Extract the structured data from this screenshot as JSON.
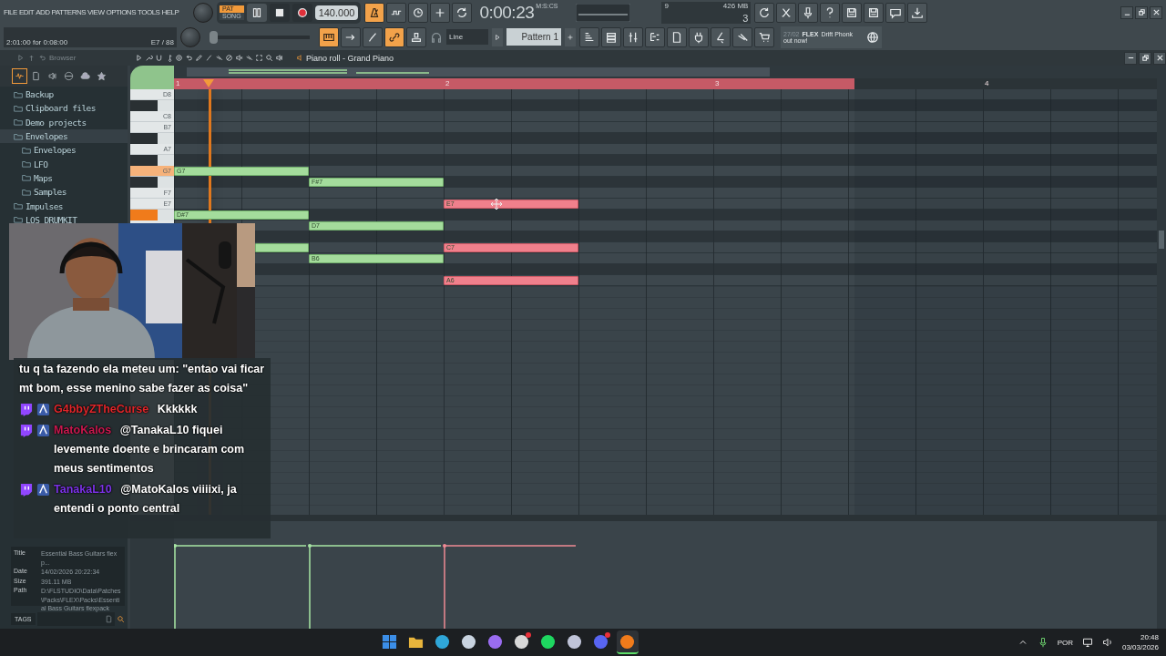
{
  "menu": [
    "FILE",
    "EDIT",
    "ADD",
    "PATTERNS",
    "VIEW",
    "OPTIONS",
    "TOOLS",
    "HELP"
  ],
  "hint": {
    "text": "2:01:00 for 0:08:00",
    "note": "E7 / 88"
  },
  "master": {
    "level": 0.0
  },
  "transport": {
    "modes": [
      {
        "label": "PAT",
        "selected": true
      },
      {
        "label": "SONG",
        "selected": false
      }
    ],
    "tempo": "140.000"
  },
  "time": {
    "label": "M:S:CS",
    "value": "0:00:23"
  },
  "monitor": {
    "polyphony": "9",
    "memory": "426 MB",
    "cpu": "3"
  },
  "snap": {
    "value": "Line"
  },
  "pattern": {
    "value": "Pattern 1"
  },
  "news": {
    "date": "27/02",
    "brand": "FLEX",
    "title": "Drift Phonk",
    "subtitle": "out now!"
  },
  "browser": {
    "title": "Browser",
    "items": [
      {
        "label": "Backup",
        "expanded": false
      },
      {
        "label": "Clipboard files",
        "expanded": false
      },
      {
        "label": "Demo projects",
        "expanded": false
      },
      {
        "label": "Envelopes",
        "expanded": true,
        "children": [
          {
            "label": "Envelopes"
          },
          {
            "label": "LFO"
          },
          {
            "label": "Maps"
          },
          {
            "label": "Samples"
          }
        ]
      },
      {
        "label": "Impulses",
        "expanded": false
      },
      {
        "label": "LOS DRUMKIT",
        "expanded": false
      }
    ],
    "info": [
      {
        "field": "Title",
        "value": "Essential Bass Guitars flexp..."
      },
      {
        "field": "Date",
        "value": "14/02/2026 20:22:34"
      },
      {
        "field": "Size",
        "value": "391.11 MB"
      },
      {
        "field": "Path",
        "value": "D:\\FLSTUDIO\\Data\\Patches\\Packs\\FLEX\\Packs\\Essential Bass Guitars flexpack"
      }
    ],
    "tags_label": "TAGS"
  },
  "piano_roll": {
    "title": "Piano roll - Grand Piano",
    "timeline": {
      "bars": [
        "1",
        "2",
        "3",
        "4"
      ],
      "song": {
        "level": 0.692
      },
      "playhead": {
        "level": 0.035
      }
    },
    "rows": [
      {
        "key": "D8",
        "black": false,
        "pressed": false
      },
      {
        "black": true,
        "pressed": false
      },
      {
        "key": "C8",
        "black": false,
        "pressed": false
      },
      {
        "key": "B7",
        "black": false,
        "pressed": false
      },
      {
        "black": true,
        "pressed": false
      },
      {
        "key": "A7",
        "black": false,
        "pressed": false
      },
      {
        "black": true,
        "pressed": false
      },
      {
        "key": "G7",
        "black": false,
        "pressed": true,
        "cells": [
          {
            "note": true,
            "selected": false,
            "label": "G7"
          },
          {
            "note": false
          },
          {
            "note": false
          }
        ]
      },
      {
        "black": true,
        "pressed": false,
        "cells": [
          {
            "note": false
          },
          {
            "note": true,
            "selected": false,
            "label": "F#7"
          },
          {
            "note": false
          }
        ]
      },
      {
        "key": "F7",
        "black": false,
        "pressed": false
      },
      {
        "key": "E7",
        "black": false,
        "pressed": false,
        "cells": [
          {
            "note": false
          },
          {
            "note": false
          },
          {
            "note": true,
            "selected": true,
            "label": "E7"
          }
        ]
      },
      {
        "black": true,
        "pressed": true,
        "cells": [
          {
            "note": true,
            "selected": false,
            "label": "D#7"
          },
          {
            "note": false
          },
          {
            "note": false
          }
        ]
      },
      {
        "black": false,
        "cells": [
          {
            "note": false
          },
          {
            "note": true,
            "selected": false,
            "label": "D7"
          },
          {
            "note": false
          }
        ]
      },
      {
        "black": true
      },
      {
        "black": false,
        "cells": [
          {
            "note": true,
            "selected": false
          },
          {
            "note": false
          },
          {
            "note": true,
            "selected": true,
            "label": "C7"
          }
        ]
      },
      {
        "black": false,
        "cells": [
          {
            "note": false
          },
          {
            "note": true,
            "selected": false,
            "label": "B6"
          },
          {
            "note": false
          }
        ]
      },
      {
        "black": true
      },
      {
        "black": false,
        "cells": [
          {
            "note": false
          },
          {
            "note": false
          },
          {
            "note": true,
            "selected": true,
            "label": "A6"
          }
        ]
      }
    ]
  },
  "chat": [
    {
      "kind": "text",
      "text": "tu q ta fazendo ela meteu um: \"entao vai ficar mt bom, esse menino sabe fazer as coisa\""
    },
    {
      "kind": "message",
      "user": "G4bbyZTheCurse",
      "color": "#e0262a",
      "text": "Kkkkkk"
    },
    {
      "kind": "message",
      "user": "MatoKalos",
      "color": "#c8184e",
      "text": "@TanakaL10 fiquei levemente doente e brincaram com meus sentimentos"
    },
    {
      "kind": "message",
      "user": "TanakaL10",
      "color": "#7b32e6",
      "text": "@MatoKalos viiiixi, ja entendi o ponto central"
    }
  ],
  "taskbar": {
    "apps": [
      {
        "selected": false,
        "badge": false
      },
      {
        "selected": false,
        "badge": false
      },
      {
        "selected": false,
        "badge": false
      },
      {
        "selected": false,
        "badge": false
      },
      {
        "selected": false,
        "badge": false
      },
      {
        "selected": false,
        "badge": true
      },
      {
        "selected": false,
        "badge": false
      },
      {
        "selected": false,
        "badge": false
      },
      {
        "selected": false,
        "badge": true
      },
      {
        "selected": true,
        "badge": false
      }
    ],
    "language": "POR",
    "time": "20:48",
    "date": "03/03/2026"
  }
}
